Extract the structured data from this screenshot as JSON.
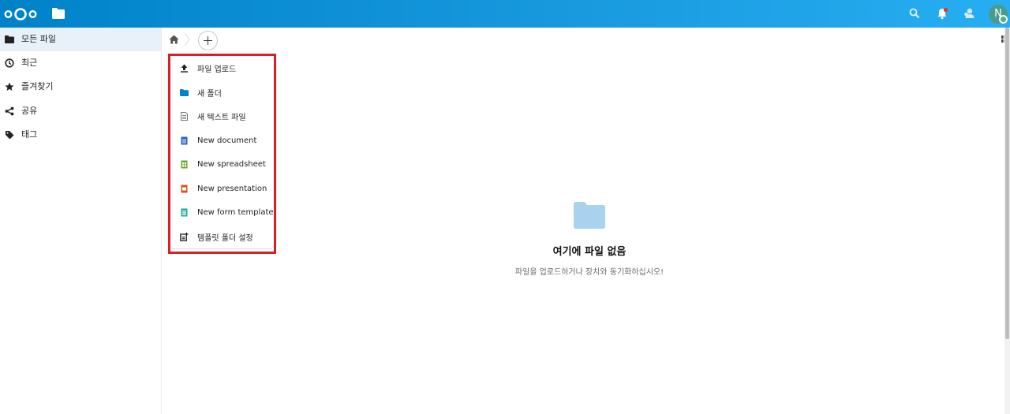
{
  "header": {
    "app_name": "Files",
    "avatar_initial": "N"
  },
  "sidebar": {
    "items": [
      {
        "label": "모든 파일",
        "icon": "folder-icon",
        "active": true
      },
      {
        "label": "최근",
        "icon": "clock-icon",
        "active": false
      },
      {
        "label": "즐겨찾기",
        "icon": "star-icon",
        "active": false
      },
      {
        "label": "공유",
        "icon": "share-icon",
        "active": false
      },
      {
        "label": "태그",
        "icon": "tag-icon",
        "active": false
      }
    ]
  },
  "breadcrumb": {
    "home_icon": "home-icon",
    "new_button_icon": "plus-icon"
  },
  "new_menu": {
    "highlight_color": "#d81e26",
    "items": [
      {
        "label": "파일 업로드",
        "icon": "upload-icon"
      },
      {
        "label": "새 폴더",
        "icon": "folder-icon"
      },
      {
        "label": "새 텍스트 파일",
        "icon": "text-file-icon"
      },
      {
        "label": "New document",
        "icon": "document-icon"
      },
      {
        "label": "New spreadsheet",
        "icon": "spreadsheet-icon"
      },
      {
        "label": "New presentation",
        "icon": "presentation-icon"
      },
      {
        "label": "New form template",
        "icon": "form-icon"
      },
      {
        "label": "템플릿 폴더 설정",
        "icon": "template-settings-icon"
      }
    ]
  },
  "empty_state": {
    "title": "여기에 파일 없음",
    "hint": "파일을 업로드하거나 장치와 동기화하십시오!"
  },
  "colors": {
    "header_start": "#0082c9",
    "header_end": "#27aef2",
    "folder": "#0082c9",
    "empty_folder": "#a9d2ef"
  }
}
